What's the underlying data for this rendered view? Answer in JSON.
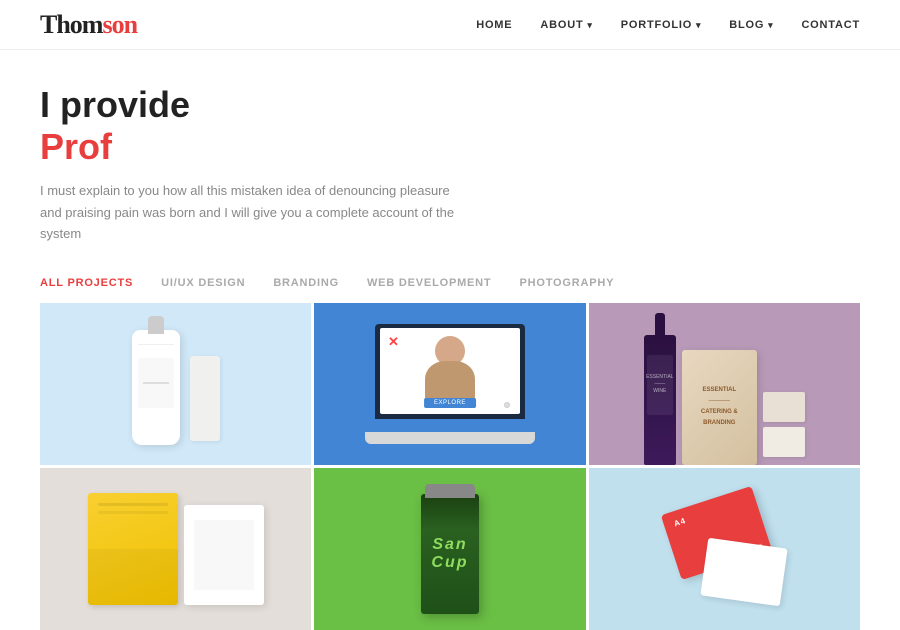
{
  "header": {
    "logo_text_main": "Thomson",
    "logo_text_highlight": "on",
    "nav": {
      "home": "HOME",
      "about": "ABOUT",
      "portfolio": "PORTFOLIO",
      "blog": "BLOG",
      "contact": "CONTACT"
    }
  },
  "hero": {
    "title_line1": "I provide",
    "title_line2": "Prof",
    "description": "I must explain to you how all this mistaken idea of denouncing pleasure and praising pain was born and I will give you a complete account of the system"
  },
  "filters": {
    "items": [
      {
        "label": "ALL PROJECTS",
        "active": true
      },
      {
        "label": "UI/UX DESIGN",
        "active": false
      },
      {
        "label": "BRANDING",
        "active": false
      },
      {
        "label": "WEB DEVELOPMENT",
        "active": false
      },
      {
        "label": "PHOTOGRAPHY",
        "active": false
      }
    ]
  },
  "portfolio": {
    "items": [
      {
        "id": 1,
        "category": "branding",
        "bg": "#d6e8f5"
      },
      {
        "id": 2,
        "category": "ui-ux",
        "bg": "#3a7bd5"
      },
      {
        "id": 3,
        "category": "branding",
        "bg": "#c4a0b8"
      },
      {
        "id": 4,
        "category": "branding",
        "bg": "#e8e4e0"
      },
      {
        "id": 5,
        "category": "branding",
        "bg": "#6abf4b"
      },
      {
        "id": 6,
        "category": "photography",
        "bg": "#c8e8f0"
      }
    ]
  },
  "colors": {
    "accent": "#e83e3e",
    "text_dark": "#222",
    "text_gray": "#777",
    "text_nav": "#333"
  }
}
